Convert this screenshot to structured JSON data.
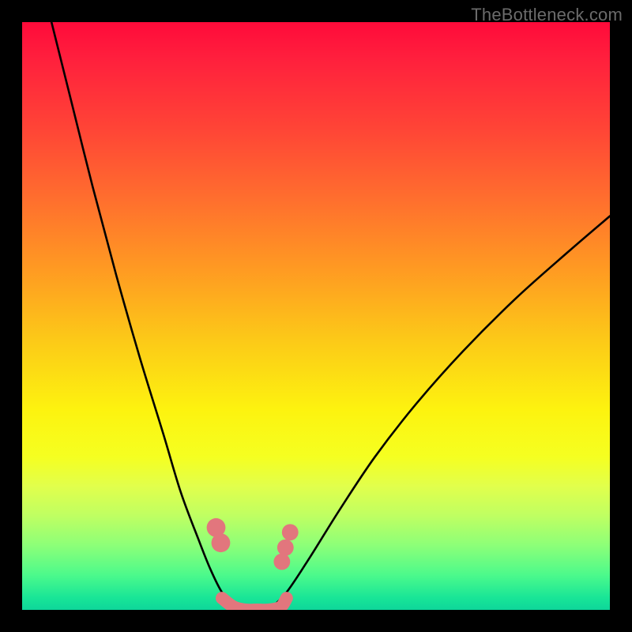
{
  "watermark": "TheBottleneck.com",
  "chart_data": {
    "type": "line",
    "title": "",
    "xlabel": "",
    "ylabel": "",
    "xlim": [
      0,
      100
    ],
    "ylim": [
      0,
      100
    ],
    "background_gradient": {
      "direction": "vertical",
      "stops": [
        {
          "pos": 0,
          "color": "#ff0a3a"
        },
        {
          "pos": 18,
          "color": "#ff4436"
        },
        {
          "pos": 42,
          "color": "#ff9a22"
        },
        {
          "pos": 66,
          "color": "#fdf30f"
        },
        {
          "pos": 84,
          "color": "#bfff62"
        },
        {
          "pos": 100,
          "color": "#0ed69a"
        }
      ]
    },
    "series": [
      {
        "name": "left-curve",
        "stroke": "#000000",
        "x": [
          5,
          8,
          12,
          16,
          20,
          24,
          27,
          30,
          32,
          34,
          36,
          38
        ],
        "y": [
          100,
          88,
          72,
          57,
          43,
          30,
          20,
          12,
          7,
          3,
          1,
          0
        ]
      },
      {
        "name": "right-curve",
        "stroke": "#000000",
        "x": [
          42,
          45,
          49,
          54,
          60,
          67,
          75,
          84,
          93,
          100
        ],
        "y": [
          0,
          3,
          9,
          17,
          26,
          35,
          44,
          53,
          61,
          67
        ]
      },
      {
        "name": "valley-floor",
        "stroke": "#e2767d",
        "x": [
          34,
          36,
          38,
          40,
          42,
          44,
          45
        ],
        "y": [
          2,
          0.5,
          0,
          0,
          0,
          0.5,
          2
        ]
      }
    ],
    "markers": [
      {
        "name": "left-dot-upper",
        "x": 33.0,
        "y": 14.0,
        "r": 1.6,
        "color": "#e2767d"
      },
      {
        "name": "left-dot-lower",
        "x": 33.8,
        "y": 11.4,
        "r": 1.6,
        "color": "#e2767d"
      },
      {
        "name": "right-dot-upper",
        "x": 45.6,
        "y": 13.2,
        "r": 1.4,
        "color": "#e2767d"
      },
      {
        "name": "right-dot-mid",
        "x": 44.8,
        "y": 10.6,
        "r": 1.4,
        "color": "#e2767d"
      },
      {
        "name": "right-dot-lower",
        "x": 44.2,
        "y": 8.2,
        "r": 1.4,
        "color": "#e2767d"
      }
    ],
    "valley_min_x": 40
  }
}
